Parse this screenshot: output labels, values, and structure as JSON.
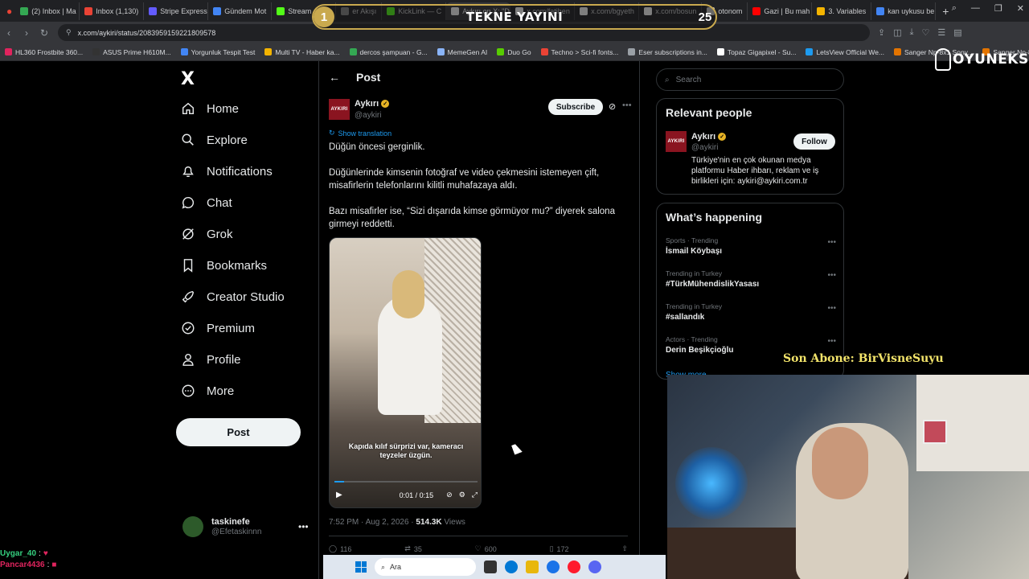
{
  "browser": {
    "tabs": [
      {
        "label": "(2) Inbox | Ma",
        "color": "#34a853"
      },
      {
        "label": "Inbox (1,130)",
        "color": "#ea4335"
      },
      {
        "label": "Stripe Express",
        "color": "#635bff"
      },
      {
        "label": "Gündem Mot",
        "color": "#4285f4"
      },
      {
        "label": "Stream - Kick",
        "color": "#53fc18"
      },
      {
        "label": "er Akışı",
        "color": "#888888"
      },
      {
        "label": "KickLink — C",
        "color": "#53fc18"
      },
      {
        "label": "Aykırı on X: \"Düğün ön",
        "color": "#ffffff"
      },
      {
        "label": "x.com/fatihen",
        "color": "#ffffff"
      },
      {
        "label": "x.com/bgyeth",
        "color": "#ffffff"
      },
      {
        "label": "x.com/bosun",
        "color": "#ffffff"
      },
      {
        "label": "otonom",
        "color": "#cccccc"
      },
      {
        "label": "Gazi | Bu mah",
        "color": "#ff0000"
      },
      {
        "label": "3. Variables",
        "color": "#f4b400"
      },
      {
        "label": "kan uykusu be",
        "color": "#4285f4"
      }
    ],
    "url": "x.com/aykiri/status/2083959159221809578",
    "bookmarks": [
      {
        "label": "HL360 Frostbite 360...",
        "color": "#e0245e"
      },
      {
        "label": "ASUS Prime H610M...",
        "color": "#333333"
      },
      {
        "label": "Yorgunluk Tespit Test",
        "color": "#4285f4"
      },
      {
        "label": "Multi TV - Haber ka...",
        "color": "#f4b400"
      },
      {
        "label": "dercos şampuan - G...",
        "color": "#34a853"
      },
      {
        "label": "MemeGen AI",
        "color": "#8ab4f8"
      },
      {
        "label": "Duo Go",
        "color": "#58cc02"
      },
      {
        "label": "Techno > Sci-fi fonts...",
        "color": "#ea4335"
      },
      {
        "label": "Eser subscriptions in...",
        "color": "#9aa0a6"
      },
      {
        "label": "Topaz Gigapixel - Su...",
        "color": "#ffffff"
      },
      {
        "label": "LetsView Official We...",
        "color": "#1d9bf0"
      },
      {
        "label": "Sanger Np-8x1 Sony...",
        "color": "#e37400"
      },
      {
        "label": "Sanger Np-8x1 Son...",
        "color": "#e37400"
      }
    ]
  },
  "stream": {
    "title": "TEKNE YAYINI",
    "left_num": "1",
    "right_num": "25",
    "brand": "OYUNEKS",
    "last_sub": "Son Abone: BirVisneSuyu",
    "chat": [
      {
        "user": "Uygar_40",
        "msg": ":",
        "color": "#35d07f"
      },
      {
        "user": "Pancar4436",
        "msg": ":",
        "color": "#e0245e"
      }
    ]
  },
  "nav": {
    "logo": "X",
    "items": [
      {
        "label": "Home",
        "icon": "home-icon"
      },
      {
        "label": "Explore",
        "icon": "search-icon"
      },
      {
        "label": "Notifications",
        "icon": "bell-icon"
      },
      {
        "label": "Chat",
        "icon": "chat-icon"
      },
      {
        "label": "Grok",
        "icon": "grok-icon"
      },
      {
        "label": "Bookmarks",
        "icon": "bookmark-icon"
      },
      {
        "label": "Creator Studio",
        "icon": "rocket-icon"
      },
      {
        "label": "Premium",
        "icon": "verified-icon"
      },
      {
        "label": "Profile",
        "icon": "person-icon"
      },
      {
        "label": "More",
        "icon": "more-icon"
      }
    ],
    "post_button": "Post",
    "account": {
      "name": "taskinefe",
      "handle": "@Efetaskinnn"
    }
  },
  "post": {
    "header": "Post",
    "author": {
      "name": "Aykırı",
      "handle": "@aykiri",
      "avatar_text": "AYKIRI"
    },
    "subscribe": "Subscribe",
    "show_translation": "Show translation",
    "paragraphs": [
      "Düğün öncesi gerginlik.",
      "Düğünlerinde kimsenin fotoğraf ve video çekmesini istemeyen çift, misafirlerin telefonlarını kilitli muhafazaya aldı.",
      "Bazı misafirler ise, “Sizi dışarıda kimse görmüyor mu?” diyerek salona girmeyi reddetti."
    ],
    "video": {
      "caption": "Kapıda kılıf sürprizi var, kameracı teyzeler üzgün.",
      "time": "0:01 / 0:15",
      "progress": 0.07
    },
    "meta": {
      "timestamp": "7:52 PM · Aug 2, 2026 · ",
      "views_num": "514.3K",
      "views_label": " Views"
    },
    "actions": {
      "replies": "116",
      "reposts": "35",
      "likes": "600",
      "bookmarks": "172"
    }
  },
  "sidebar": {
    "search_placeholder": "Search",
    "relevant_title": "Relevant people",
    "relevant": {
      "name": "Aykırı",
      "handle": "@aykiri",
      "follow": "Follow",
      "bio": "Türkiye'nin en çok okunan medya platformu Haber ihbarı, reklam ve iş birlikleri için: aykiri@aykiri.com.tr"
    },
    "happening_title": "What’s happening",
    "trends": [
      {
        "context": "Sports · Trending",
        "topic": "İsmail Köybaşı"
      },
      {
        "context": "Trending in Turkey",
        "topic": "#TürkMühendislikYasası"
      },
      {
        "context": "Trending in Turkey",
        "topic": "#sallandık"
      },
      {
        "context": "Actors · Trending",
        "topic": "Derin Beşikçioğlu"
      }
    ],
    "show_more": "Show more"
  },
  "taskbar": {
    "search": "Ara"
  }
}
